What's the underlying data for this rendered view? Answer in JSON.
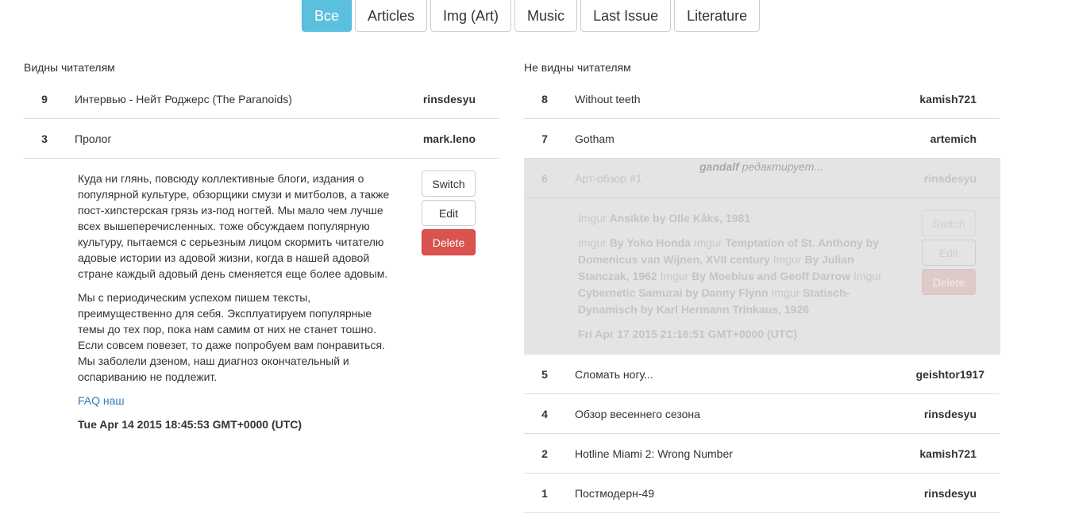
{
  "tabs": [
    {
      "label": "Все",
      "active": true
    },
    {
      "label": "Articles",
      "active": false
    },
    {
      "label": "Img (Art)",
      "active": false
    },
    {
      "label": "Music",
      "active": false
    },
    {
      "label": "Last Issue",
      "active": false
    },
    {
      "label": "Literature",
      "active": false
    }
  ],
  "visible": {
    "title": "Видны читателям",
    "rows": [
      {
        "num": "9",
        "title": "Интервью - Нейт Роджерс (The Paranoids)",
        "author": "rinsdesyu"
      },
      {
        "num": "3",
        "title": "Пролог",
        "author": "mark.leno"
      }
    ],
    "expanded": {
      "paragraphs": [
        "Куда ни глянь, повсюду коллективные блоги, издания о популярной культуре, обзорщики смузи и митболов, а также пост-хипстерская грязь из-под ногтей. Мы мало чем лучше всех вышеперечисленных. тоже обсуждаем популярную культуру, пытаемся с серьезным лицом скормить читателю адовые истории из адовой жизни, когда в нашей адовой стране каждый адовый день сменяется еще более адовым.",
        "Мы с периодическим успехом пишем тексты, преимущественно для себя. Эксплуатируем популярные темы до тех пор, пока нам самим от них не станет тошно. Если совсем повезет, то даже попробуем вам понравиться. Мы заболели дзеном, наш диагноз окончательный и оспариванию не подлежит."
      ],
      "link": "FAQ наш",
      "date": "Tue Apr 14 2015 18:45:53 GMT+0000 (UTC)",
      "buttons": {
        "switch": "Switch",
        "edit": "Edit",
        "delete": "Delete"
      }
    }
  },
  "hidden": {
    "title": "Не видны читателям",
    "rows_top": [
      {
        "num": "8",
        "title": "Without teeth",
        "author": "kamish721"
      },
      {
        "num": "7",
        "title": "Gotham",
        "author": "artemich"
      }
    ],
    "locked": {
      "num": "6",
      "title": "Арт-обзор #1",
      "author": "rinsdesyu",
      "editor": "gandalf",
      "editing_text": "редактирует...",
      "imgur_label": "Imgur",
      "first_caption": "Ansikte by Olle Kåks, 1981",
      "captions": [
        "By Yoko Honda",
        "Temptation of St. Anthony by Domenicus van Wijnen, XVII century",
        "By Julian Stanczak, 1962",
        "By Moebius and Geoff Darrow",
        "Cybernetic Samurai by Danny Flynn",
        "Statisch-Dynamisch by Karl Hermann Trinkaus, 1926"
      ],
      "date": "Fri Apr 17 2015 21:16:51 GMT+0000 (UTC)",
      "buttons": {
        "switch": "Switch",
        "edit": "Edit",
        "delete": "Delete"
      }
    },
    "rows_bottom": [
      {
        "num": "5",
        "title": "Сломать ногу...",
        "author": "geishtor1917"
      },
      {
        "num": "4",
        "title": "Обзор весеннего сезона",
        "author": "rinsdesyu"
      },
      {
        "num": "2",
        "title": "Hotline Miami 2: Wrong Number",
        "author": "kamish721"
      },
      {
        "num": "1",
        "title": "Постмодерн-49",
        "author": "rinsdesyu"
      }
    ]
  }
}
